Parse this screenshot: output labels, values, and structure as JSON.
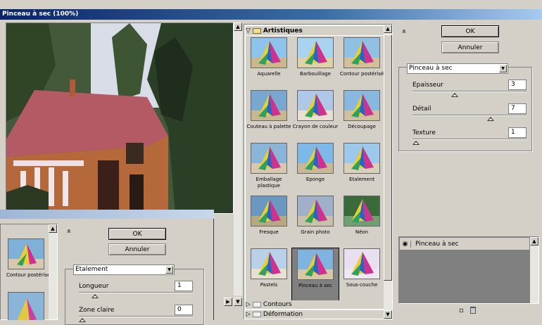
{
  "window": {
    "title": "Pinceau à sec (100%)"
  },
  "buttons": {
    "ok": "OK",
    "cancel": "Annuler"
  },
  "gallery": {
    "open_category": "Artistiques",
    "filters": [
      "Aquarelle",
      "Barbouillage",
      "Contour postérisé",
      "Couteau à palette",
      "Crayon de couleur",
      "Découpage",
      "Emballage plastique",
      "Eponge",
      "Etalement",
      "Fresque",
      "Grain photo",
      "Néon",
      "Pastels",
      "Pinceau à sec",
      "Sous-couche"
    ],
    "selected_filter": "Pinceau à sec",
    "collapsed_categories": [
      "Contours",
      "Déformation"
    ]
  },
  "settings": {
    "filter_select": "Pinceau à sec",
    "params": [
      {
        "label": "Epaisseur",
        "value": "3",
        "level": 0.36
      },
      {
        "label": "Détail",
        "value": "7",
        "level": 0.7
      },
      {
        "label": "Texture",
        "value": "1",
        "level": 0.0
      }
    ]
  },
  "layers": {
    "items": [
      {
        "label": "Pinceau à sec"
      }
    ]
  },
  "secondary": {
    "thumb_label": "Contour postérisé",
    "filter_select": "Etalement",
    "params": [
      {
        "label": "Longueur",
        "value": "1",
        "level": 0.12
      },
      {
        "label": "Zone claire",
        "value": "0",
        "level": 0.0
      }
    ]
  },
  "icons": {
    "scroll_up": "▲",
    "scroll_down": "▼",
    "scroll_left": "◀",
    "scroll_right": "▶",
    "collapse": "»",
    "expand_open": "▽",
    "expand_closed": "▷",
    "dropdown": "▼",
    "eye": "◉",
    "new_layer": "▫",
    "trash": "🗑"
  }
}
